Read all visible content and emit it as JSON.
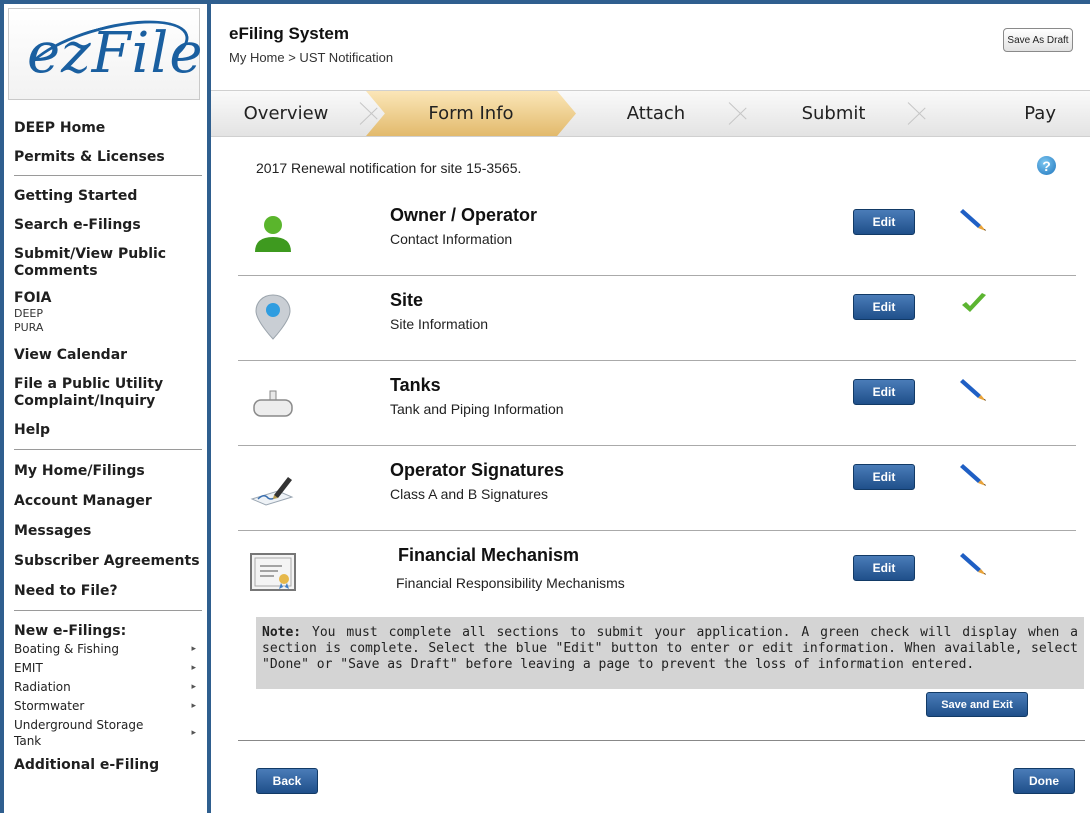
{
  "logo": {
    "text": "ezFile"
  },
  "sidebar": {
    "top_links": [
      "DEEP Home",
      "Permits & Licenses"
    ],
    "group1": [
      "Getting Started",
      "Search e-Filings",
      "Submit/View Public Comments"
    ],
    "foia": {
      "label": "FOIA",
      "subs": [
        "DEEP",
        "PURA"
      ]
    },
    "group2": [
      "View Calendar",
      "File a Public Utility Complaint/Inquiry",
      "Help"
    ],
    "group3": [
      "My Home/Filings",
      "Account Manager",
      "Messages",
      "Subscriber Agreements",
      "Need to File?"
    ],
    "new_filings": {
      "heading": "New e-Filings:",
      "items": [
        "Boating & Fishing",
        "EMIT",
        "Radiation",
        "Stormwater",
        "Underground Storage Tank"
      ]
    },
    "additional_heading": "Additional e-Filing"
  },
  "header": {
    "title": "eFiling System",
    "breadcrumb": "My Home > UST Notification",
    "save_draft": "Save As Draft"
  },
  "steps": [
    "Overview",
    "Form Info",
    "Attach",
    "Submit",
    "Pay"
  ],
  "active_step": "Form Info",
  "intro": "2017 Renewal notification for site 15-3565.",
  "help_icon": "?",
  "sections": [
    {
      "title": "Owner / Operator",
      "subtitle": "Contact Information",
      "icon": "person-icon",
      "status": "pencil-icon"
    },
    {
      "title": "Site",
      "subtitle": "Site Information",
      "icon": "location-pin-icon",
      "status": "checkmark-icon"
    },
    {
      "title": "Tanks",
      "subtitle": "Tank and Piping Information",
      "icon": "tank-icon",
      "status": "pencil-icon"
    },
    {
      "title": "Operator Signatures",
      "subtitle": "Class A and B Signatures",
      "icon": "signature-icon",
      "status": "pencil-icon"
    },
    {
      "title": "Financial Mechanism",
      "subtitle": "Financial Responsibility Mechanisms",
      "icon": "certificate-icon",
      "status": "pencil-icon"
    }
  ],
  "edit_label": "Edit",
  "note": {
    "label": "Note:",
    "text": "You must complete all sections to submit your application. A green check will display when a section is complete. Select the blue \"Edit\" button to enter or edit information. When available, select \"Done\" or \"Save as Draft\" before leaving a page to prevent the loss of information entered."
  },
  "buttons": {
    "save_exit": "Save and Exit",
    "back": "Back",
    "done": "Done"
  },
  "colors": {
    "frame": "#2f5f8f",
    "button": "#1f4f8a",
    "active_step": "#e2ba6c",
    "check": "#5cb531"
  }
}
